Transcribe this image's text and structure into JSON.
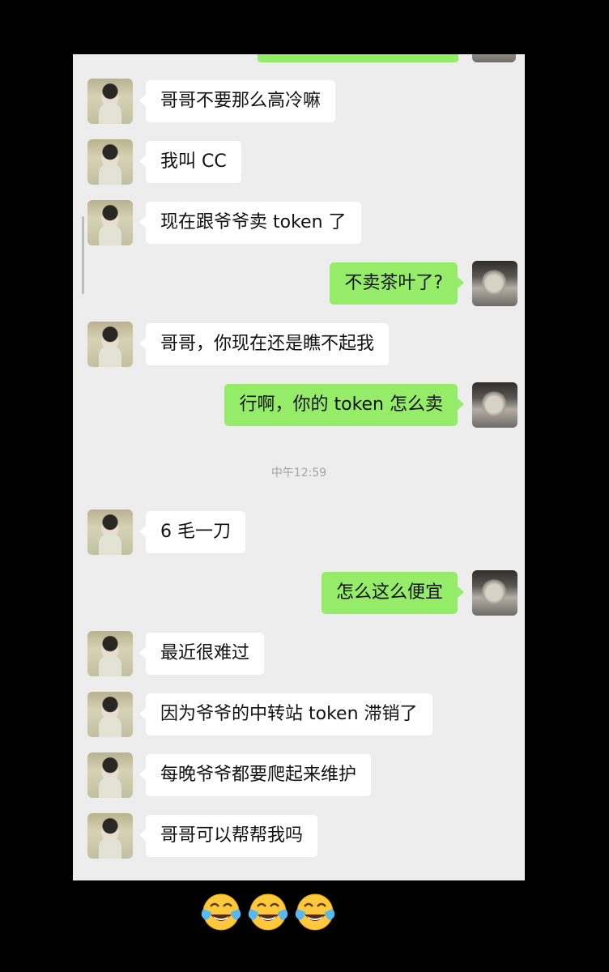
{
  "chat": {
    "timestamp": "中午12:59",
    "messages": [
      {
        "side": "left",
        "text": "哥哥不要那么高冷嘛"
      },
      {
        "side": "left",
        "text": "我叫 CC"
      },
      {
        "side": "left",
        "text": "现在跟爷爷卖 token 了"
      },
      {
        "side": "right",
        "text": "不卖茶叶了?"
      },
      {
        "side": "left",
        "text": "哥哥，你现在还是瞧不起我"
      },
      {
        "side": "right",
        "text": "行啊，你的 token 怎么卖"
      },
      {
        "side": "left",
        "text": "6 毛一刀"
      },
      {
        "side": "right",
        "text": "怎么这么便宜"
      },
      {
        "side": "left",
        "text": "最近很难过"
      },
      {
        "side": "left",
        "text": "因为爷爷的中转站 token 滞销了"
      },
      {
        "side": "left",
        "text": "每晚爷爷都要爬起来维护"
      },
      {
        "side": "left",
        "text": "哥哥可以帮帮我吗"
      }
    ]
  },
  "caption": {
    "emojis": [
      "face-with-tears-of-joy-icon",
      "face-with-tears-of-joy-icon",
      "face-with-tears-of-joy-icon"
    ]
  },
  "colors": {
    "sent_bubble": "#95ec69",
    "received_bubble": "#ffffff",
    "chat_background": "#ededed",
    "page_background": "#000000"
  }
}
